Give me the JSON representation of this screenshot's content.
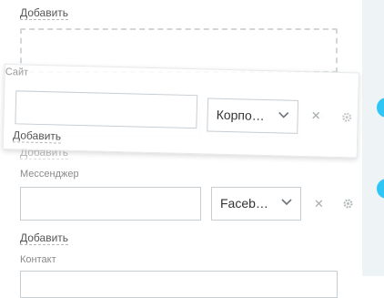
{
  "top_block": {
    "add_label": "Добавить"
  },
  "site_block": {
    "label": "Сайт",
    "value": "",
    "type_selected": "Корпо…",
    "add_label": "Добавить",
    "ghost_add_label": "Добавить"
  },
  "messenger_block": {
    "label": "Мессенджер",
    "value": "",
    "type_selected": "Faceb…",
    "add_label": "Добавить"
  },
  "contact_block": {
    "label": "Контакт"
  },
  "colors": {
    "accent": "#2fc6f6",
    "border": "#c6cdd3",
    "sidebar_bg": "#eef3f5"
  },
  "icons": [
    "chevron-down-icon",
    "close-icon",
    "gear-icon"
  ]
}
